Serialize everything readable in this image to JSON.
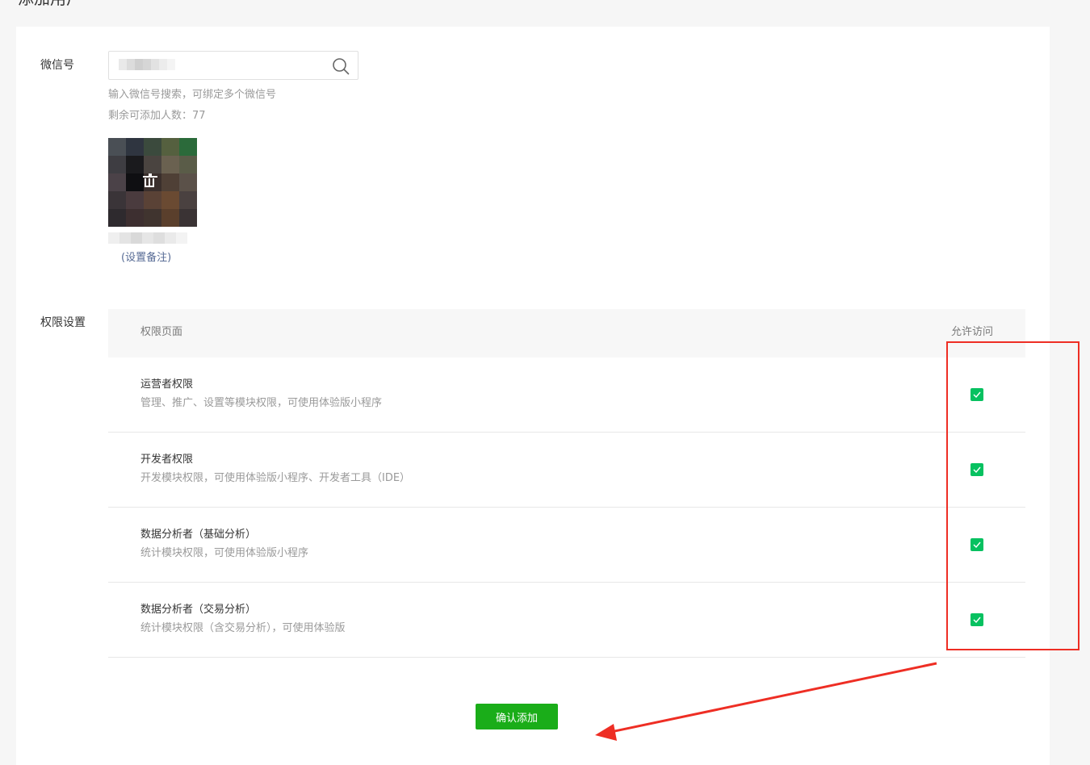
{
  "page": {
    "title": "添加用户"
  },
  "form": {
    "wechat_label": "微信号",
    "search_placeholder": "",
    "search_hint": "输入微信号搜索，可绑定多个微信号",
    "remaining_label": "剩余可添加人数：77",
    "remark_link": "(设置备注)"
  },
  "permissions": {
    "label": "权限设置",
    "columns": [
      "权限页面",
      "允许访问"
    ],
    "rows": [
      {
        "title": "运营者权限",
        "desc": "管理、推广、设置等模块权限，可使用体验版小程序",
        "checked": true
      },
      {
        "title": "开发者权限",
        "desc": "开发模块权限，可使用体验版小程序、开发者工具（IDE）",
        "checked": true
      },
      {
        "title": "数据分析者（基础分析）",
        "desc": "统计模块权限，可使用体验版小程序",
        "checked": true
      },
      {
        "title": "数据分析者（交易分析）",
        "desc": "统计模块权限（含交易分析），可使用体验版",
        "checked": true
      }
    ]
  },
  "actions": {
    "confirm_label": "确认添加"
  },
  "colors": {
    "accent_green": "#1aad19",
    "checkbox_green": "#07c160",
    "link_blue": "#576b95",
    "annotation_red": "#ee2e24"
  }
}
